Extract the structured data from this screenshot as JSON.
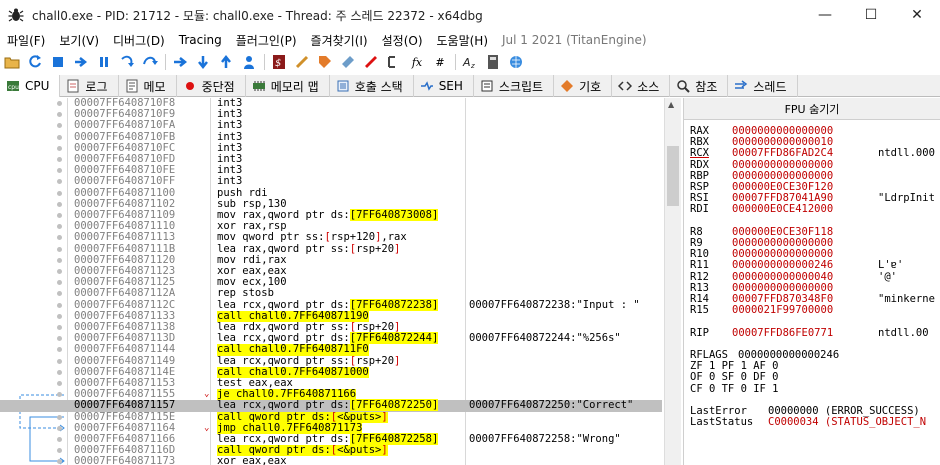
{
  "window": {
    "title": "chall0.exe - PID: 21712 - 모듈: chall0.exe - Thread: 주 스레드 22372 - x64dbg",
    "min_label": "—",
    "max_label": "☐",
    "close_label": "✕"
  },
  "menu": [
    "파일(F)",
    "보기(V)",
    "디버그(D)",
    "Tracing",
    "플러그인(P)",
    "즐겨찾기(I)",
    "설정(O)",
    "도움말(H)",
    "Jul 1 2021 (TitanEngine)"
  ],
  "toolbar": {
    "icons": [
      "open-icon",
      "restart-icon",
      "stop-icon",
      "run-icon",
      "pause-icon",
      "step-into-icon",
      "step-over-icon",
      "trace-into-icon",
      "trace-over-icon",
      "execute-till-return-icon",
      "run-to-user-code-icon",
      "script-icon",
      "comment-icon",
      "label-icon",
      "bookmark-icon",
      "function-icon",
      "fx-icon",
      "hash-icon",
      "font-icon",
      "calculator-icon",
      "globe-icon"
    ],
    "fx_label": "fx",
    "hash_label": "#"
  },
  "tabs": [
    {
      "label": "CPU",
      "icon": "cpu-icon",
      "active": true
    },
    {
      "label": "로그",
      "icon": "log-icon",
      "active": false
    },
    {
      "label": "메모",
      "icon": "notes-icon",
      "active": false
    },
    {
      "label": "중단점",
      "icon": "breakpoint-icon",
      "active": false
    },
    {
      "label": "메모리 맵",
      "icon": "memory-map-icon",
      "active": false
    },
    {
      "label": "호출 스택",
      "icon": "call-stack-icon",
      "active": false
    },
    {
      "label": "SEH",
      "icon": "seh-icon",
      "active": false
    },
    {
      "label": "스크립트",
      "icon": "script-tab-icon",
      "active": false
    },
    {
      "label": "기호",
      "icon": "symbols-icon",
      "active": false
    },
    {
      "label": "소스",
      "icon": "source-icon",
      "active": false
    },
    {
      "label": "참조",
      "icon": "references-icon",
      "active": false
    },
    {
      "label": "스레드",
      "icon": "threads-icon",
      "active": false
    }
  ],
  "disasm": [
    {
      "addr": "00007FF6408710F8",
      "ins": "int3",
      "cmt": ""
    },
    {
      "addr": "00007FF6408710F9",
      "ins": "int3",
      "cmt": ""
    },
    {
      "addr": "00007FF6408710FA",
      "ins": "int3",
      "cmt": ""
    },
    {
      "addr": "00007FF6408710FB",
      "ins": "int3",
      "cmt": ""
    },
    {
      "addr": "00007FF6408710FC",
      "ins": "int3",
      "cmt": ""
    },
    {
      "addr": "00007FF6408710FD",
      "ins": "int3",
      "cmt": ""
    },
    {
      "addr": "00007FF6408710FE",
      "ins": "int3",
      "cmt": ""
    },
    {
      "addr": "00007FF6408710FF",
      "ins": "int3",
      "cmt": ""
    },
    {
      "addr": "00007FF640871100",
      "ins": "push rdi",
      "cmt": ""
    },
    {
      "addr": "00007FF640871102",
      "ins": "sub rsp,130",
      "cmt": ""
    },
    {
      "addr": "00007FF640871109",
      "ins": "mov rax,qword ptr ds:[7FF640873008]",
      "cmt": ""
    },
    {
      "addr": "00007FF640871110",
      "ins": "xor rax,rsp",
      "cmt": ""
    },
    {
      "addr": "00007FF640871113",
      "ins": "mov qword ptr ss:[rsp+120],rax",
      "cmt": ""
    },
    {
      "addr": "00007FF64087111B",
      "ins": "lea rax,qword ptr ss:[rsp+20]",
      "cmt": ""
    },
    {
      "addr": "00007FF640871120",
      "ins": "mov rdi,rax",
      "cmt": ""
    },
    {
      "addr": "00007FF640871123",
      "ins": "xor eax,eax",
      "cmt": ""
    },
    {
      "addr": "00007FF640871125",
      "ins": "mov ecx,100",
      "cmt": ""
    },
    {
      "addr": "00007FF64087112A",
      "ins": "rep stosb",
      "cmt": ""
    },
    {
      "addr": "00007FF64087112C",
      "ins": "lea rcx,qword ptr ds:[7FF640872238]",
      "cmt": "00007FF640872238:\"Input : \""
    },
    {
      "addr": "00007FF640871133",
      "ins": "call chall0.7FF640871190",
      "cmt": ""
    },
    {
      "addr": "00007FF640871138",
      "ins": "lea rdx,qword ptr ss:[rsp+20]",
      "cmt": ""
    },
    {
      "addr": "00007FF64087113D",
      "ins": "lea rcx,qword ptr ds:[7FF640872244]",
      "cmt": "00007FF640872244:\"%256s\""
    },
    {
      "addr": "00007FF640871144",
      "ins": "call chall0.7FF6408711F0",
      "cmt": ""
    },
    {
      "addr": "00007FF640871149",
      "ins": "lea rcx,qword ptr ss:[rsp+20]",
      "cmt": ""
    },
    {
      "addr": "00007FF64087114E",
      "ins": "call chall0.7FF640871000",
      "cmt": ""
    },
    {
      "addr": "00007FF640871153",
      "ins": "test eax,eax",
      "cmt": ""
    },
    {
      "addr": "00007FF640871155",
      "ins": "je chall0.7FF640871166",
      "cmt": ""
    },
    {
      "addr": "00007FF640871157",
      "ins": "lea rcx,qword ptr ds:[7FF640872250]",
      "cmt": "00007FF640872250:\"Correct\""
    },
    {
      "addr": "00007FF64087115E",
      "ins": "call qword ptr ds:[<&puts>]",
      "cmt": ""
    },
    {
      "addr": "00007FF640871164",
      "ins": "jmp chall0.7FF640871173",
      "cmt": ""
    },
    {
      "addr": "00007FF640871166",
      "ins": "lea rcx,qword ptr ds:[7FF640872258]",
      "cmt": "00007FF640872258:\"Wrong\""
    },
    {
      "addr": "00007FF64087116D",
      "ins": "call qword ptr ds:[<&puts>]",
      "cmt": ""
    },
    {
      "addr": "00007FF640871173",
      "ins": "xor eax,eax",
      "cmt": ""
    }
  ],
  "regs": {
    "header": "FPU 숨기기",
    "rows": [
      {
        "name": "RAX",
        "val": "0000000000000000",
        "info": ""
      },
      {
        "name": "RBX",
        "val": "0000000000000010",
        "info": ""
      },
      {
        "name": "RCX",
        "val": "00007FFD86FAD2C4",
        "info": "ntdll.000"
      },
      {
        "name": "RDX",
        "val": "0000000000000000",
        "info": ""
      },
      {
        "name": "RBP",
        "val": "0000000000000000",
        "info": ""
      },
      {
        "name": "RSP",
        "val": "000000E0CE30F120",
        "info": ""
      },
      {
        "name": "RSI",
        "val": "00007FFD87041A90",
        "info": "\"LdrpInit"
      },
      {
        "name": "RDI",
        "val": "000000E0CE412000",
        "info": ""
      },
      {
        "name": "R8",
        "val": "000000E0CE30F118",
        "info": ""
      },
      {
        "name": "R9",
        "val": "0000000000000000",
        "info": ""
      },
      {
        "name": "R10",
        "val": "0000000000000000",
        "info": ""
      },
      {
        "name": "R11",
        "val": "0000000000000246",
        "info": "L'ɐ'"
      },
      {
        "name": "R12",
        "val": "0000000000000040",
        "info": "'@'"
      },
      {
        "name": "R13",
        "val": "0000000000000000",
        "info": ""
      },
      {
        "name": "R14",
        "val": "00007FFD870348F0",
        "info": "\"minkerne"
      },
      {
        "name": "R15",
        "val": "0000021F99700000",
        "info": ""
      },
      {
        "name": "RIP",
        "val": "00007FFD86FE0771",
        "info": "ntdll.00"
      },
      {
        "name": "RFLAGS",
        "val": "0000000000000246",
        "info": ""
      },
      {
        "name": "flags1",
        "val": "ZF 1  PF 1  AF 0",
        "info": ""
      },
      {
        "name": "flags2",
        "val": "OF 0  SF 0  DF 0",
        "info": ""
      },
      {
        "name": "flags3",
        "val": "CF 0  TF 0  IF 1",
        "info": ""
      },
      {
        "name": "LastError",
        "val": "00000000 (ERROR_SUCCESS)",
        "info": ""
      },
      {
        "name": "LastStatus",
        "val": "C0000034 (STATUS_OBJECT_N",
        "info": ""
      }
    ]
  },
  "colors": {
    "accent_red": "#c00000",
    "highlight_yellow": "#ffff00",
    "selected_row": "#c0c0c0"
  }
}
